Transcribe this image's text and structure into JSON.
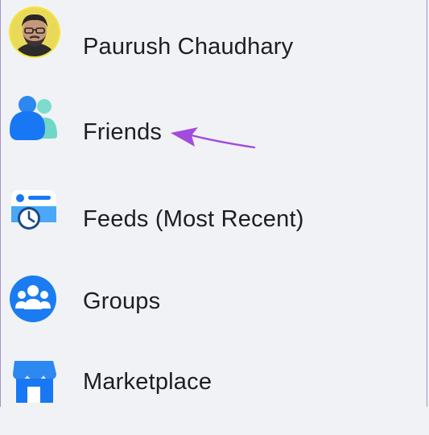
{
  "menu": {
    "items": [
      {
        "id": "profile",
        "label": "Paurush Chaudhary",
        "icon": "user-avatar"
      },
      {
        "id": "friends",
        "label": "Friends",
        "icon": "friends-icon"
      },
      {
        "id": "feeds",
        "label": "Feeds (Most Recent)",
        "icon": "feeds-clock-icon"
      },
      {
        "id": "groups",
        "label": "Groups",
        "icon": "groups-icon"
      },
      {
        "id": "marketplace",
        "label": "Marketplace",
        "icon": "marketplace-store-icon"
      }
    ]
  },
  "annotation": {
    "arrow_color": "#a24bdc",
    "target": "friends"
  },
  "colors": {
    "background": "#f0f2f5",
    "text": "#1c1e21",
    "brand_blue": "#1877f2",
    "teal": "#6fd6c8"
  }
}
